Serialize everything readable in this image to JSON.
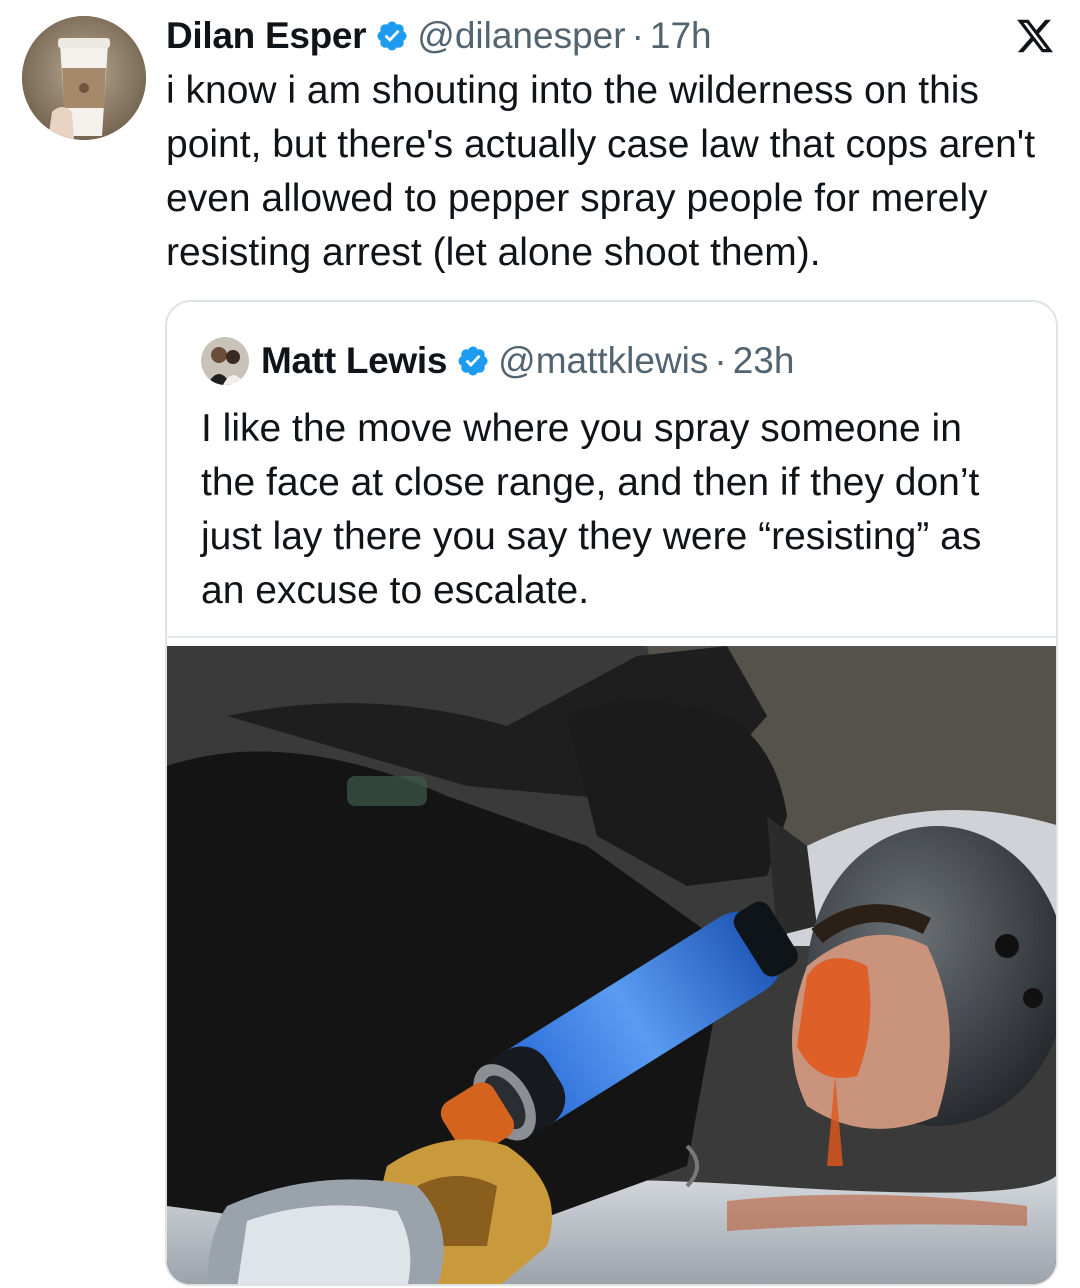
{
  "tweet": {
    "author_name": "Dilan Esper",
    "handle": "@dilanesper",
    "separator": "·",
    "time": "17h",
    "text": "i know i am shouting into the wilderness on this point, but there's actually case law that cops aren't even allowed to pepper spray people for merely resisting arrest (let alone shoot them).",
    "verified_color": "#1d9bf0"
  },
  "brand": {
    "icon": "x-logo-icon"
  },
  "quoted_tweet": {
    "author_name": "Matt Lewis",
    "handle": "@mattklewis",
    "separator": "·",
    "time": "23h",
    "text": "I like the move where you spray someone in the face at close range, and then if they don’t just lay there you say they were “resisting” as an excuse to escalate."
  },
  "colors": {
    "text": "#0f1419",
    "secondary": "#536471",
    "border": "#dfe3e6",
    "accent": "#1d9bf0"
  }
}
